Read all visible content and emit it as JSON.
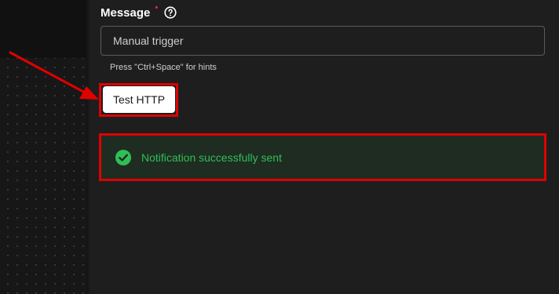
{
  "form": {
    "message_label": "Message",
    "required_marker": "•",
    "help_icon": "question-circle-icon",
    "message_value": "Manual trigger",
    "hint": "Press \"Ctrl+Space\" for hints",
    "test_button_label": "Test HTTP"
  },
  "alert": {
    "icon": "check-circle-icon",
    "text": "Notification successfully sent"
  },
  "colors": {
    "background": "#1e1e1e",
    "required": "#e0245e",
    "success": "#2fbf55",
    "annotation": "#e00000"
  }
}
